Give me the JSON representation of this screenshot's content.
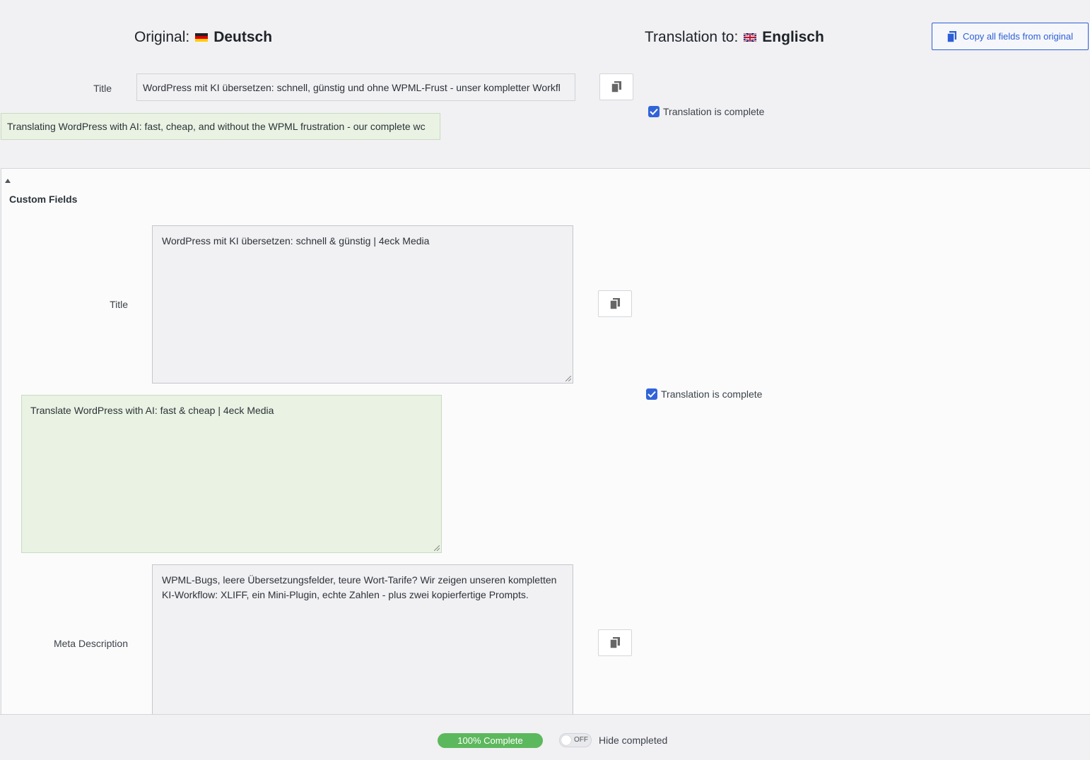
{
  "header": {
    "original_label": "Original:",
    "original_language": "Deutsch",
    "translation_label": "Translation to:",
    "translation_language": "Englisch",
    "copy_all_label": "Copy all fields from original"
  },
  "title_field": {
    "label": "Title",
    "original_value": "WordPress mit KI übersetzen: schnell, günstig und ohne WPML-Frust - unser kompletter Workfl",
    "translation_value": "Translating WordPress with AI: fast, cheap, and without the WPML frustration - our complete wc",
    "complete_label": "Translation is complete"
  },
  "custom_fields": {
    "toggle_icon": "triangle-up-icon",
    "heading": "Custom Fields",
    "fields": [
      {
        "label": "Title",
        "original_value": "WordPress mit KI übersetzen: schnell & günstig | 4eck Media",
        "translation_value": "Translate WordPress with AI: fast & cheap | 4eck Media",
        "complete_label": "Translation is complete"
      },
      {
        "label": "Meta Description",
        "original_value": "WPML-Bugs, leere Übersetzungsfelder, teure Wort-Tarife? Wir zeigen unseren kompletten KI-Workflow: XLIFF, ein Mini-Plugin, echte Zahlen - plus zwei kopierfertige Prompts."
      }
    ]
  },
  "footer": {
    "progress_label": "100% Complete",
    "progress_fraction": 1.0,
    "toggle_state": "OFF",
    "hide_completed_label": "Hide completed"
  },
  "colors": {
    "accent_blue": "#2c5fd6",
    "checkbox_blue": "#3164d8",
    "progress_green": "#5cb85c",
    "translated_bg": "#e9f2e3"
  }
}
